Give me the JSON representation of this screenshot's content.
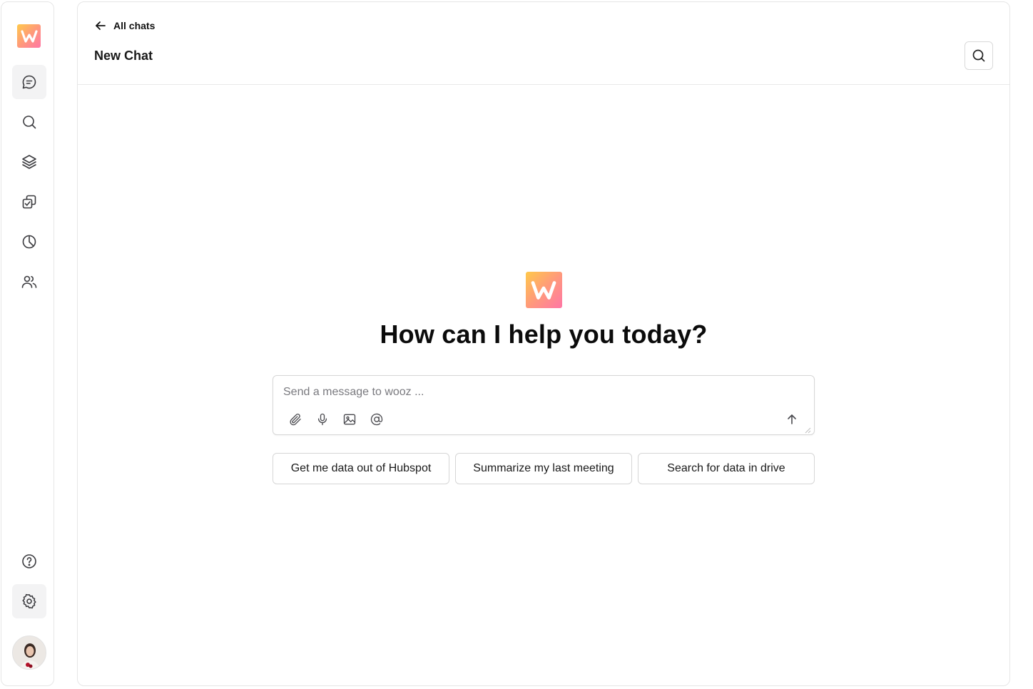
{
  "sidebar": {
    "logo": "wooz-logo",
    "items": [
      {
        "icon": "chat-icon",
        "active": true
      },
      {
        "icon": "search-icon",
        "active": false
      },
      {
        "icon": "layers-icon",
        "active": false
      },
      {
        "icon": "checkbox-stack-icon",
        "active": false
      },
      {
        "icon": "pie-chart-icon",
        "active": false
      },
      {
        "icon": "users-icon",
        "active": false
      }
    ],
    "bottom_items": [
      {
        "icon": "help-icon",
        "active": false
      },
      {
        "icon": "gear-icon",
        "active": true
      }
    ],
    "avatar": "user-avatar"
  },
  "header": {
    "back_label": "All chats",
    "title": "New Chat",
    "search_icon": "search-icon"
  },
  "hero": {
    "title": "How can I help you today?"
  },
  "composer": {
    "placeholder": "Send a message to wooz ...",
    "value": "",
    "tools": [
      "paperclip-icon",
      "microphone-icon",
      "image-icon",
      "at-sign-icon"
    ],
    "send_icon": "arrow-up-icon"
  },
  "suggestions": [
    "Get me data out of Hubspot",
    "Summarize my last meeting",
    "Search for data in drive"
  ],
  "colors": {
    "brand_gradient_start": "#ffc94a",
    "brand_gradient_end": "#ff76a6",
    "border": "#e6e6e6",
    "active_nav_bg": "#f3f3f4"
  }
}
